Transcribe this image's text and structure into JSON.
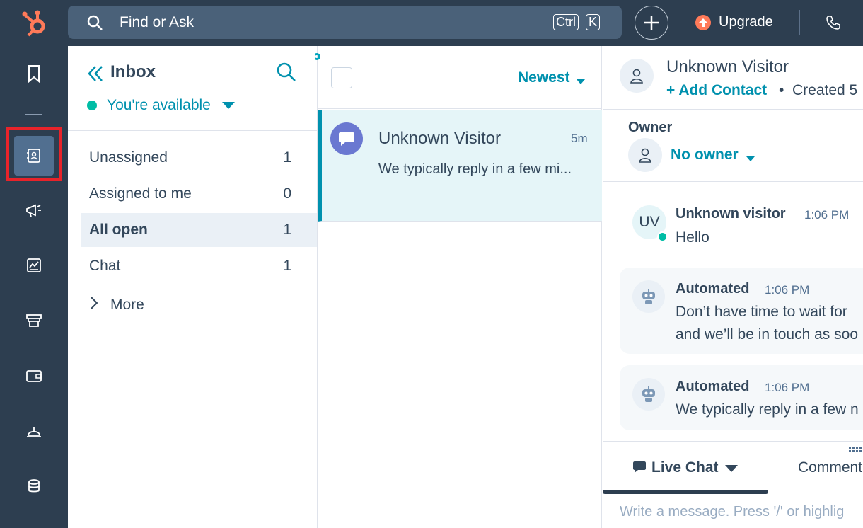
{
  "topbar": {
    "search_placeholder": "Find or Ask",
    "shortcut_ctrl": "Ctrl",
    "shortcut_k": "K",
    "upgrade_label": "Upgrade"
  },
  "rail": {
    "items": [
      "bookmark-icon",
      "contacts-icon",
      "marketing-icon",
      "reports-icon",
      "commerce-icon",
      "wallet-icon",
      "service-icon",
      "data-icon"
    ],
    "active_index": 1
  },
  "inbox": {
    "title": "Inbox",
    "availability": "You're available",
    "filters": [
      {
        "label": "Unassigned",
        "count": "1"
      },
      {
        "label": "Assigned to me",
        "count": "0"
      },
      {
        "label": "All open",
        "count": "1"
      },
      {
        "label": "Chat",
        "count": "1"
      }
    ],
    "active_filter": 2,
    "more_label": "More"
  },
  "conversation_list": {
    "sort_label": "Newest",
    "items": [
      {
        "name": "Unknown Visitor",
        "time": "5m",
        "preview": "We typically reply in a few mi..."
      }
    ]
  },
  "detail": {
    "title": "Unknown Visitor",
    "add_contact": "+ Add Contact",
    "bullet": "•",
    "created": "Created 5",
    "owner_label": "Owner",
    "owner_value": "No owner",
    "messages": [
      {
        "author": "Unknown visitor",
        "initials": "UV",
        "time": "1:06 PM",
        "lines": [
          "Hello"
        ]
      },
      {
        "author": "Automated",
        "time": "1:06 PM",
        "lines": [
          "Don’t have time to wait for",
          "and we’ll be in touch as soo"
        ]
      },
      {
        "author": "Automated",
        "time": "1:06 PM",
        "lines": [
          "We typically reply in a few n"
        ]
      }
    ],
    "tab_live_chat": "Live Chat",
    "tab_comment": "Comment",
    "composer_placeholder": "Write a message. Press '/' or highlig"
  },
  "colors": {
    "nav_bg": "#2d3e50",
    "accent_teal": "#0091ae",
    "status_green": "#00bda5",
    "selected_row": "#e5f5f8",
    "highlight_red": "#e8232a"
  }
}
